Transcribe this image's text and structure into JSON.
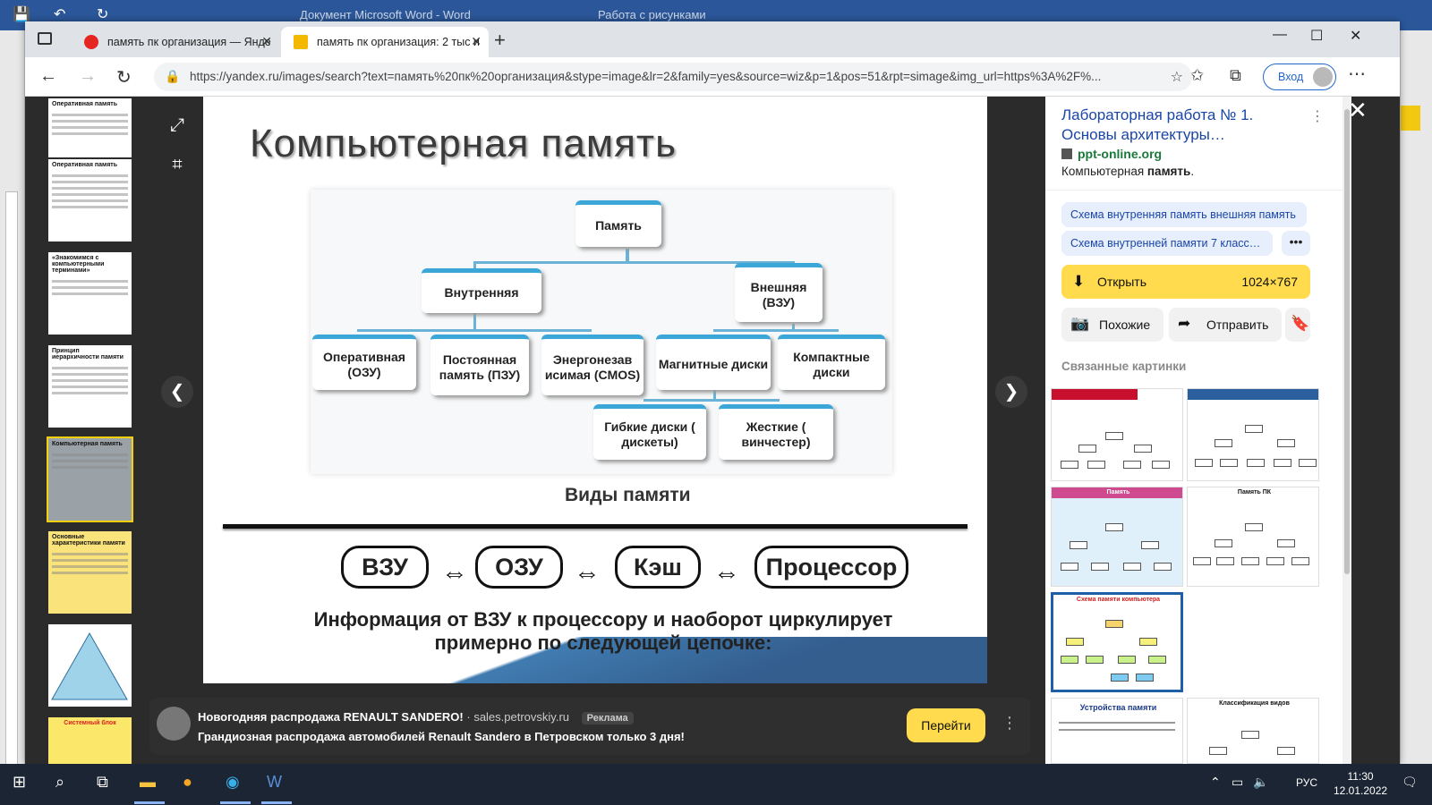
{
  "word": {
    "title": "Документ Microsoft Word - Word",
    "context_tab": "Работа с рисунками"
  },
  "browser": {
    "tabs": [
      {
        "label": "память пк организация — Янде",
        "favicon_color": "#e52620"
      },
      {
        "label": "память пк организация: 2 тыс и",
        "favicon_color": "#f5b800"
      }
    ],
    "url": "https://yandex.ru/images/search?text=память%20пк%20организация&stype=image&lr=2&family=yes&source=wiz&p=1&pos=51&rpt=simage&img_url=https%3A%2F%...",
    "login_label": "Вход"
  },
  "slide": {
    "title": "Компьютерная память",
    "nodes": {
      "root": "Память",
      "internal": "Внутренняя",
      "external": "Внешняя (ВЗУ)",
      "ram": "Оперативная (ОЗУ)",
      "rom": "Постоянная память (ПЗУ)",
      "cmos": "Энергонезав исимая (CMOS)",
      "magnetic": "Магнитные диски",
      "compact": "Компактные диски",
      "floppy": "Гибкие диски ( дискеты)",
      "hard": "Жесткие ( винчестер)"
    },
    "caption": "Виды памяти",
    "chain": [
      "ВЗУ",
      "ОЗУ",
      "Кэш",
      "Процессор"
    ],
    "info": "Информация от ВЗУ к процессору и наоборот циркулирует примерно по следующей цепочке:"
  },
  "thumbnails": [
    {
      "title": "Оперативная память",
      "selected": false
    },
    {
      "title": "Оперативная память",
      "selected": false
    },
    {
      "title": "«Знакомимся с компьютерными терминами»",
      "selected": false
    },
    {
      "title": "Принцип иерархичности памяти",
      "selected": false
    },
    {
      "title": "Компьютерная память",
      "selected": true
    },
    {
      "title": "Основные характеристики памяти",
      "selected": false
    },
    {
      "title": "",
      "selected": false
    },
    {
      "title": "Системный блок",
      "selected": false
    }
  ],
  "ad": {
    "headline": "Новогодняя распродажа RENAULT SANDERO!",
    "domain": "· sales.petrovskiy.ru",
    "tag": "Реклама",
    "text": "Грандиозная распродажа автомобилей Renault Sandero в Петровском только 3 дня!",
    "button": "Перейти"
  },
  "panel": {
    "title": "Лабораторная работа № 1. Основы архитектуры…",
    "site": "ppt-online.org",
    "desc_prefix": "Компьютерная ",
    "desc_bold": "память",
    "chips": [
      "Схема внутренняя память внешняя память",
      "Схема внутренней памяти 7 класс…"
    ],
    "open_label": "Открыть",
    "size": "1024×767",
    "similar": "Похожие",
    "share": "Отправить",
    "related_label": "Связанные картинки"
  },
  "taskbar": {
    "lang": "РУС",
    "time": "11:30",
    "date": "12.01.2022"
  },
  "colors": {
    "accent_yellow": "#ffdb4d",
    "link_blue": "#1a46a8",
    "word_blue": "#2b579a",
    "node_blue": "#3aa7d8"
  }
}
